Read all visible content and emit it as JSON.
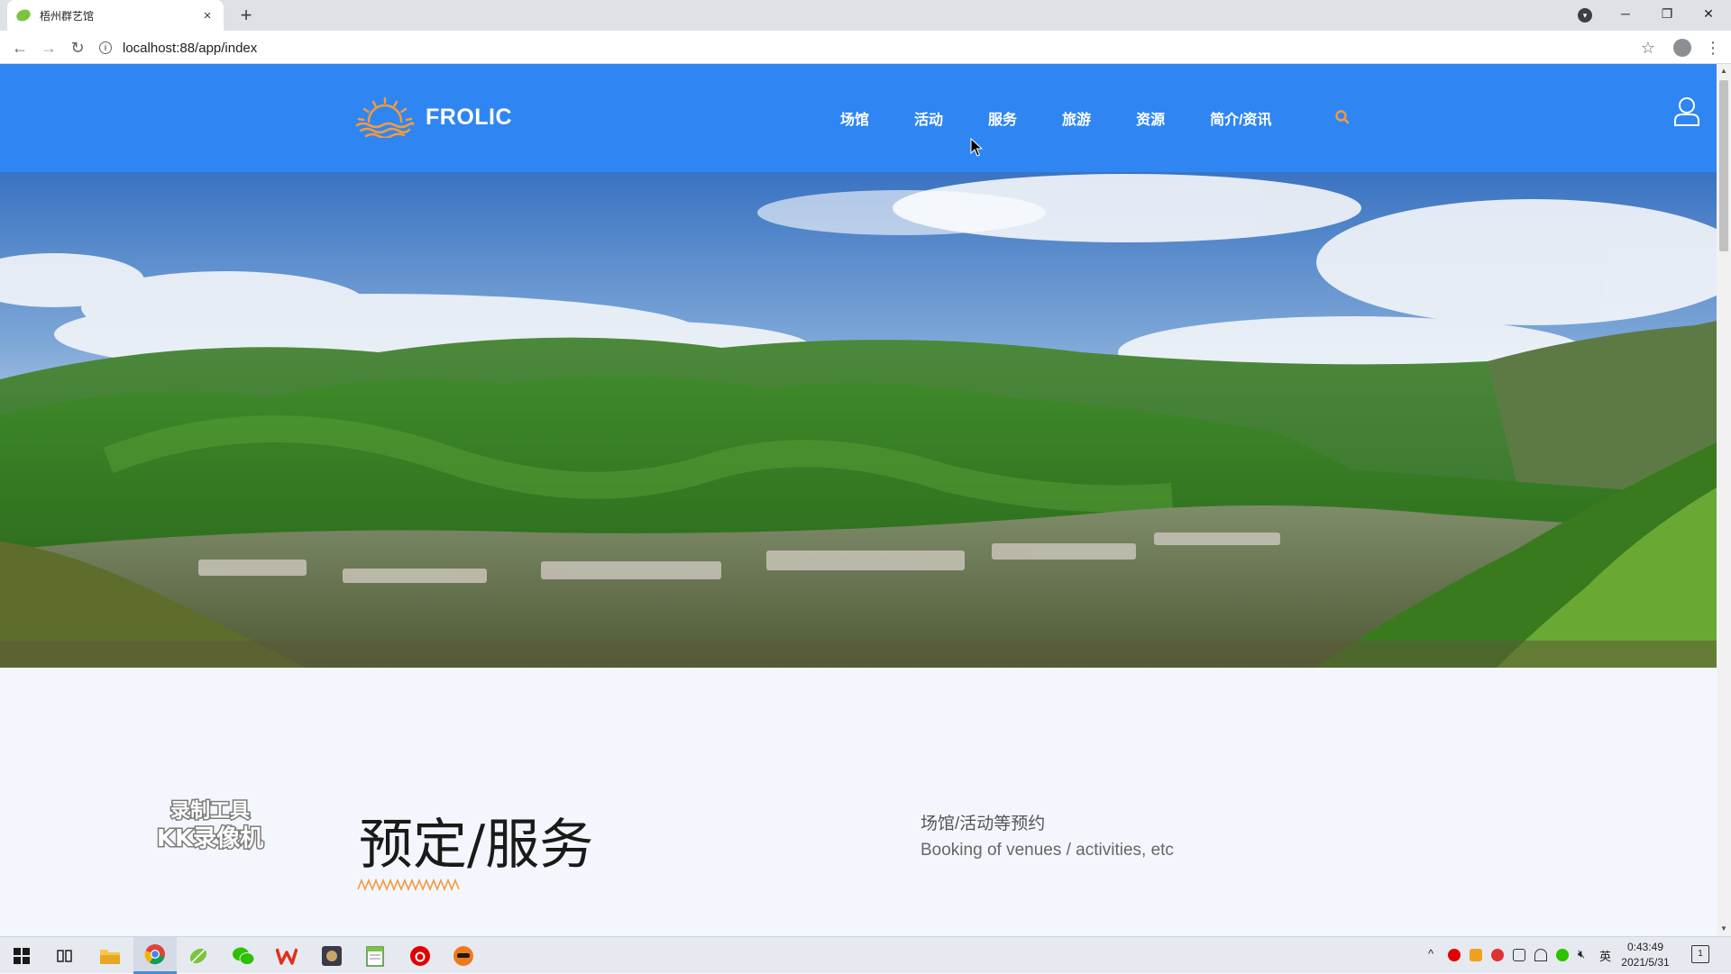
{
  "browser": {
    "tab_title": "梧州群艺馆",
    "tab_close": "×",
    "new_tab": "+",
    "url": "localhost:88/app/index",
    "window_controls": {
      "minimize": "─",
      "restore": "❐",
      "close": "✕"
    }
  },
  "site": {
    "logo_text": "FROLIC",
    "nav": [
      "场馆",
      "活动",
      "服务",
      "旅游",
      "资源",
      "简介/资讯"
    ],
    "accent_color": "#f39b3d",
    "header_color": "#2f86f2"
  },
  "section": {
    "title": "预定/服务",
    "subtitle_cn": "场馆/活动等预约",
    "subtitle_en": "Booking of venues / activities, etc"
  },
  "watermark": {
    "line1": "录制工具",
    "line2": "KK录像机"
  },
  "taskbar": {
    "apps": [
      "windows-start-icon",
      "task-view-icon",
      "file-explorer-icon",
      "chrome-icon",
      "leaf-app-icon",
      "wechat-icon",
      "wps-icon",
      "app-icon",
      "notepad-icon",
      "netease-music-icon",
      "media-icon"
    ],
    "ime": "英",
    "time": "0:43:49",
    "date": "2021/5/31",
    "notification_count": "1"
  }
}
